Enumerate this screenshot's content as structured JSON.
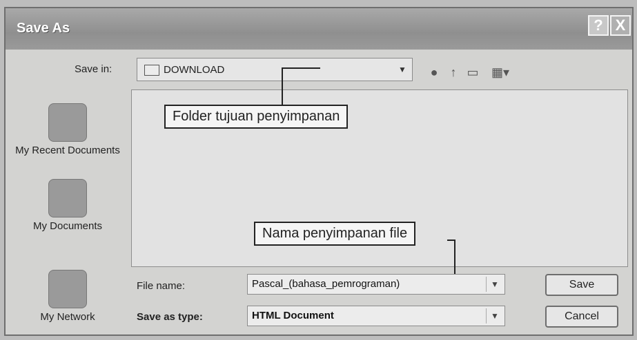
{
  "dialog": {
    "title": "Save As",
    "help_button": "?",
    "close_button": "X"
  },
  "save_in": {
    "label": "Save in:",
    "value": "DOWNLOAD"
  },
  "toolbar": {
    "back_icon": "back-icon",
    "up_icon": "up-folder-icon",
    "new_folder_icon": "new-folder-icon",
    "views_icon": "views-menu-icon"
  },
  "places": [
    {
      "label": "My Recent Documents",
      "icon": "recent-documents-icon"
    },
    {
      "label": "My Documents",
      "icon": "my-documents-icon"
    },
    {
      "label": "My Network",
      "icon": "my-network-icon"
    }
  ],
  "annotations": {
    "folder_callout": "Folder tujuan penyimpanan",
    "filename_callout": "Nama penyimpanan file"
  },
  "file_name": {
    "label": "File name:",
    "value": "Pascal_(bahasa_pemrograman)"
  },
  "save_as_type": {
    "label": "Save as type:",
    "value": "HTML Document"
  },
  "buttons": {
    "save": "Save",
    "cancel": "Cancel"
  }
}
